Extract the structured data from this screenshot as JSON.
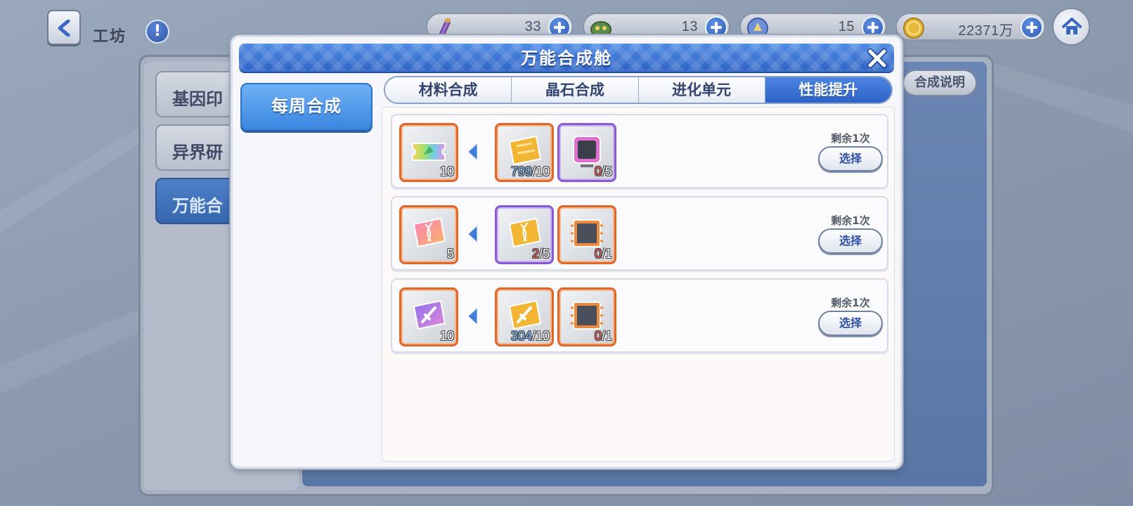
{
  "header": {
    "title": "工坊",
    "resources": [
      {
        "name": "potion",
        "value": "33"
      },
      {
        "name": "dragon-gem",
        "value": "13"
      },
      {
        "name": "crystal-orb",
        "value": "15"
      },
      {
        "name": "gold-coin",
        "value": "22371万"
      }
    ]
  },
  "background": {
    "tabs": [
      "基因印",
      "异界研",
      "万能合"
    ],
    "help_label": "合成说明"
  },
  "modal": {
    "title": "万能合成舱",
    "side_tab": "每周合成",
    "tabs": [
      "材料合成",
      "晶石合成",
      "进化单元",
      "性能提升"
    ],
    "active_tab": "性能提升",
    "recipes": [
      {
        "output": {
          "icon": "rainbow-ticket-icon",
          "qty": "10"
        },
        "inputs": [
          {
            "icon": "gold-ticket-icon",
            "have": "799",
            "need": "/10",
            "have_color": "#7db3ef"
          },
          {
            "icon": "pink-screen-icon",
            "have": "0",
            "need": "/5",
            "have_color": "#ef5b5b"
          }
        ],
        "remain": "剩余1次",
        "button": "选择"
      },
      {
        "output": {
          "icon": "pink-dna-card-icon",
          "qty": "5"
        },
        "inputs": [
          {
            "icon": "gold-dna-card-icon",
            "have": "2",
            "need": "/5",
            "have_color": "#ef5b5b"
          },
          {
            "icon": "dark-chip-icon",
            "have": "0",
            "need": "/1",
            "have_color": "#ef5b5b"
          }
        ],
        "remain": "剩余1次",
        "button": "选择"
      },
      {
        "output": {
          "icon": "purple-sword-card-icon",
          "qty": "10"
        },
        "inputs": [
          {
            "icon": "gold-sword-card-icon",
            "have": "304",
            "need": "/10",
            "have_color": "#7db3ef"
          },
          {
            "icon": "dark-chip-icon",
            "have": "0",
            "need": "/1",
            "have_color": "#ef5b5b"
          }
        ],
        "remain": "剩余1次",
        "button": "选择"
      }
    ]
  }
}
